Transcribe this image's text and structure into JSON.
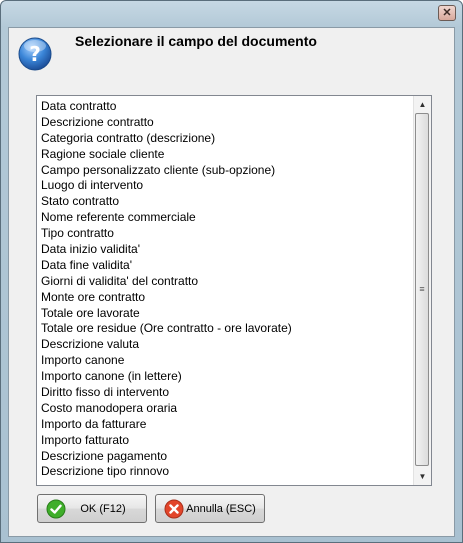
{
  "dialog": {
    "heading": "Selezionare il campo del documento"
  },
  "titlebar": {
    "close_glyph": "✕"
  },
  "list": {
    "items": [
      "Data contratto",
      "Descrizione contratto",
      "Categoria contratto (descrizione)",
      "Ragione sociale cliente",
      "Campo personalizzato cliente (sub-opzione)",
      "Luogo di intervento",
      "Stato contratto",
      "Nome referente commerciale",
      "Tipo contratto",
      "Data inizio validita'",
      "Data fine validita'",
      "Giorni di validita' del contratto",
      "Monte ore contratto",
      "Totale ore lavorate",
      "Totale ore residue (Ore contratto - ore lavorate)",
      "Descrizione valuta",
      "Importo canone",
      "Importo canone (in lettere)",
      "Diritto fisso di intervento",
      "Costo manodopera oraria",
      "Importo da fatturare",
      "Importo fatturato",
      "Descrizione pagamento",
      "Descrizione tipo rinnovo"
    ],
    "scroll_up_glyph": "▲",
    "scroll_down_glyph": "▼",
    "grip_glyph": "≡"
  },
  "buttons": {
    "ok_label": "OK (F12)",
    "cancel_label": "Annulla (ESC)"
  },
  "icons": {
    "dialog": "question-icon",
    "ok": "check-icon",
    "cancel": "cancel-x-icon",
    "close": "close-icon"
  },
  "colors": {
    "ok_icon": "#3fae2a",
    "cancel_icon": "#e2452a",
    "question_icon": "#2f77c9"
  }
}
